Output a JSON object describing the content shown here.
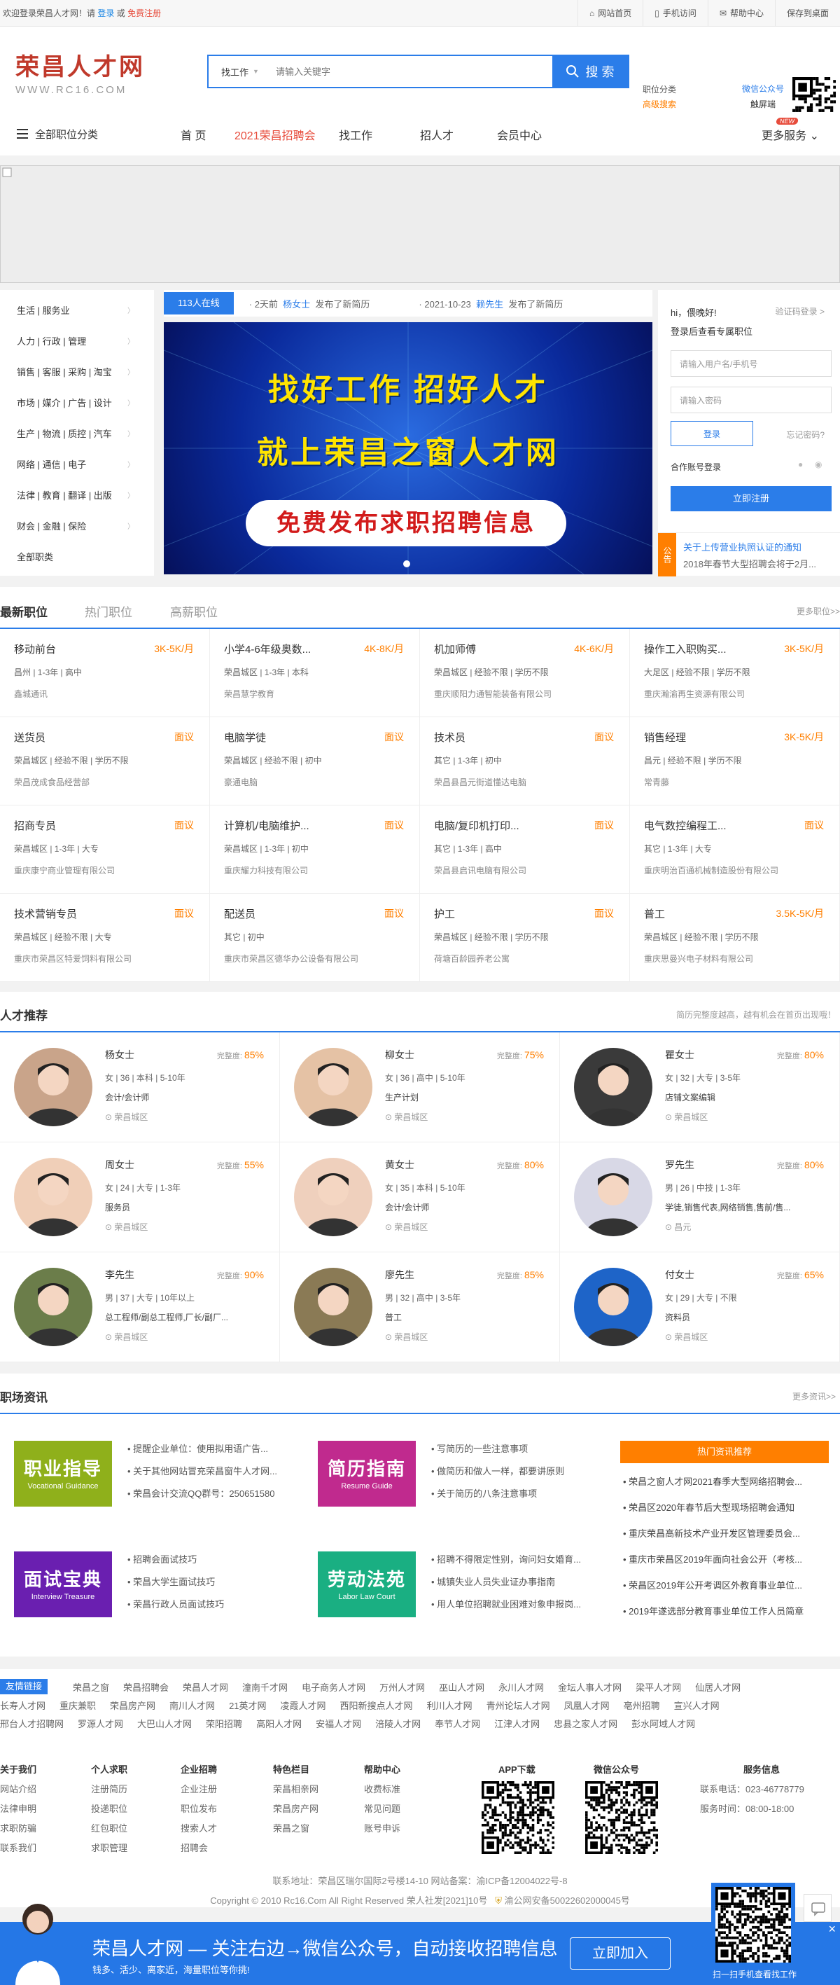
{
  "topbar": {
    "welcome": "欢迎登录荣昌人才网！请",
    "login": "登录",
    "or": "或",
    "register": "免费注册",
    "links": [
      "网站首页",
      "手机访问",
      "帮助中心",
      "保存到桌面"
    ]
  },
  "header": {
    "logo_cn": "荣昌人才网",
    "logo_en": "WWW.RC16.COM",
    "search_type": "找工作",
    "search_placeholder": "请输入关键字",
    "search_btn": "搜 索",
    "link_category": "职位分类",
    "link_advanced": "高级搜索",
    "wechat_title": "微信公众号",
    "wechat_sub": "触屏端"
  },
  "nav": {
    "category": "全部职位分类",
    "items": [
      "首 页",
      "2021荣昌招聘会",
      "找工作",
      "招人才",
      "会员中心"
    ],
    "new_badge": "NEW",
    "more": "更多服务"
  },
  "categories": [
    "生活 | 服务业",
    "人力 | 行政 | 管理",
    "销售 | 客服 | 采购 | 淘宝",
    "市场 | 媒介 | 广告 | 设计",
    "生产 | 物流 | 质控 | 汽车",
    "网络 | 通信 | 电子",
    "法律 | 教育 | 翻译 | 出版",
    "财会 | 金融 | 保险",
    "全部职类"
  ],
  "online": {
    "count": "113人在线",
    "entries": [
      {
        "time": "2天前",
        "who": "杨女士",
        "act": "发布了新简历"
      },
      {
        "time": "2021-10-23",
        "who": "赖先生",
        "act": "发布了新简历"
      }
    ]
  },
  "slide": {
    "line1": "找好工作 招好人才",
    "line2": "就上荣昌之窗人才网",
    "pill": "免费发布求职招聘信息"
  },
  "loginbox": {
    "hi": "hi，偎晚好!",
    "code_login": "验证码登录 >",
    "tip": "登录后查看专属职位",
    "user_ph": "请输入用户名/手机号",
    "pwd_ph": "请输入密码",
    "login": "登录",
    "forgot": "忘记密码?",
    "oauth": "合作账号登录",
    "register": "立即注册",
    "notice_tag": "公告",
    "notice1": "关于上传营业执照认证的通知",
    "notice2": "2018年春节大型招聘会将于2月..."
  },
  "job_tabs": [
    "最新职位",
    "热门职位",
    "高薪职位"
  ],
  "job_more": "更多职位>>",
  "jobs": [
    {
      "title": "移动前台",
      "salary": "3K-5K/月",
      "meta": "昌州 | 1-3年 | 高中",
      "company": "鑫城通讯"
    },
    {
      "title": "小学4-6年级奥数...",
      "salary": "4K-8K/月",
      "meta": "荣昌城区 | 1-3年 | 本科",
      "company": "荣昌慧学教育"
    },
    {
      "title": "机加师傅",
      "salary": "4K-6K/月",
      "meta": "荣昌城区 | 经验不限 | 学历不限",
      "company": "重庆顺阳力通智能装备有限公司"
    },
    {
      "title": "操作工入职购买...",
      "salary": "3K-5K/月",
      "meta": "大足区 | 经验不限 | 学历不限",
      "company": "重庆瀚渝再生资源有限公司"
    },
    {
      "title": "送货员",
      "salary": "面议",
      "meta": "荣昌城区 | 经验不限 | 学历不限",
      "company": "荣昌茂成食品经营部"
    },
    {
      "title": "电脑学徒",
      "salary": "面议",
      "meta": "荣昌城区 | 经验不限 | 初中",
      "company": "豪通电脑"
    },
    {
      "title": "技术员",
      "salary": "面议",
      "meta": "其它 | 1-3年 | 初中",
      "company": "荣昌县昌元街道懂达电脑"
    },
    {
      "title": "销售经理",
      "salary": "3K-5K/月",
      "meta": "昌元 | 经验不限 | 学历不限",
      "company": "常青藤"
    },
    {
      "title": "招商专员",
      "salary": "面议",
      "meta": "荣昌城区 | 1-3年 | 大专",
      "company": "重庆康宁商业管理有限公司"
    },
    {
      "title": "计算机/电脑维护...",
      "salary": "面议",
      "meta": "荣昌城区 | 1-3年 | 初中",
      "company": "重庆耀力科技有限公司"
    },
    {
      "title": "电脑/复印机打印...",
      "salary": "面议",
      "meta": "其它 | 1-3年 | 高中",
      "company": "荣昌县启讯电脑有限公司"
    },
    {
      "title": "电气数控编程工...",
      "salary": "面议",
      "meta": "其它 | 1-3年 | 大专",
      "company": "重庆明治百通机械制造股份有限公司"
    },
    {
      "title": "技术营销专员",
      "salary": "面议",
      "meta": "荣昌城区 | 经验不限 | 大专",
      "company": "重庆市荣昌区特爱饲料有限公司"
    },
    {
      "title": "配送员",
      "salary": "面议",
      "meta": "其它 | 初中",
      "company": "重庆市荣昌区德华办公设备有限公司"
    },
    {
      "title": "护工",
      "salary": "面议",
      "meta": "荣昌城区 | 经验不限 | 学历不限",
      "company": "荷塘百龄园养老公寓"
    },
    {
      "title": "普工",
      "salary": "3.5K-5K/月",
      "meta": "荣昌城区 | 经验不限 | 学历不限",
      "company": "重庆思曼兴电子材料有限公司"
    }
  ],
  "talent_section": {
    "title": "人才推荐",
    "note": "简历完整度越高，越有机会在首页出现哦！"
  },
  "talents": [
    {
      "name": "杨女士",
      "label": "完整度:",
      "pct": "85%",
      "info": "女 | 36 | 本科 | 5-10年",
      "job": "会计/会计师",
      "area": "荣昌城区"
    },
    {
      "name": "柳女士",
      "label": "完整度:",
      "pct": "75%",
      "info": "女 | 36 | 高中 | 5-10年",
      "job": "生产计划",
      "area": "荣昌城区"
    },
    {
      "name": "瞿女士",
      "label": "完整度:",
      "pct": "80%",
      "info": "女 | 32 | 大专 | 3-5年",
      "job": "店铺文案编辑",
      "area": "荣昌城区"
    },
    {
      "name": "周女士",
      "label": "完整度:",
      "pct": "55%",
      "info": "女 | 24 | 大专 | 1-3年",
      "job": "服务员",
      "area": "荣昌城区"
    },
    {
      "name": "黄女士",
      "label": "完整度:",
      "pct": "80%",
      "info": "女 | 35 | 本科 | 5-10年",
      "job": "会计/会计师",
      "area": "荣昌城区"
    },
    {
      "name": "罗先生",
      "label": "完整度:",
      "pct": "80%",
      "info": "男 | 26 | 中技 | 1-3年",
      "job": "学徒,销售代表,网络销售,售前/售...",
      "area": "昌元"
    },
    {
      "name": "李先生",
      "label": "完整度:",
      "pct": "90%",
      "info": "男 | 37 | 大专 | 10年以上",
      "job": "总工程师/副总工程师,厂长/副厂...",
      "area": "荣昌城区"
    },
    {
      "name": "廖先生",
      "label": "完整度:",
      "pct": "85%",
      "info": "男 | 32 | 高中 | 3-5年",
      "job": "普工",
      "area": "荣昌城区"
    },
    {
      "name": "付女士",
      "label": "完整度:",
      "pct": "65%",
      "info": "女 | 29 | 大专 | 不限",
      "job": "资料员",
      "area": "荣昌城区"
    }
  ],
  "news_section": {
    "title": "职场资讯",
    "more": "更多资讯>>"
  },
  "news_boxes": [
    {
      "big": "职业指导",
      "sm": "Vocational Guidance",
      "color": "#8fb01b",
      "list": [
        "提醒企业单位：使用拟用语广告...",
        "关于其他网站冒充荣昌窗牛人才网...",
        "荣昌会计交流QQ群号：250651580"
      ]
    },
    {
      "big": "简历指南",
      "sm": "Resume Guide",
      "color": "#c02a8e",
      "list": [
        "写简历的一些注意事项",
        "做简历和做人一样，都要讲原则",
        "关于简历的八条注意事项"
      ]
    },
    {
      "big": "面试宝典",
      "sm": "Interview Treasure",
      "color": "#6a1fb0",
      "list": [
        "招聘会面试技巧",
        "荣昌大学生面试技巧",
        "荣昌行政人员面试技巧"
      ]
    },
    {
      "big": "劳动法苑",
      "sm": "Labor Law Court",
      "color": "#1aaf82",
      "list": [
        "招聘不得限定性别，询问妇女婚育...",
        "城镇失业人员失业证办事指南",
        "用人单位招聘就业困难对象申报岗..."
      ]
    }
  ],
  "hot_news": {
    "title": "热门资讯推荐",
    "items": [
      "荣昌之窗人才网2021春季大型网络招聘会...",
      "荣昌区2020年春节后大型现场招聘会通知",
      "重庆荣昌高新技术产业开发区管理委员会...",
      "重庆市荣昌区2019年面向社会公开（考核...",
      "荣昌区2019年公开考调区外教育事业单位...",
      "2019年遂选部分教育事业单位工作人员简章"
    ]
  },
  "links": {
    "tag": "友情链接",
    "row1": [
      "荣昌之窗",
      "荣昌招聘会",
      "荣昌人才网",
      "潼南千才网",
      "电子商务人才网",
      "万州人才网",
      "巫山人才网",
      "永川人才网",
      "金坛人事人才网",
      "梁平人才网",
      "仙居人才网"
    ],
    "row2": [
      "长寿人才网",
      "重庆兼职",
      "荣昌房产网",
      "南川人才网",
      "21英才网",
      "凌霞人才网",
      "西阳新搜点人才网",
      "利川人才网",
      "青州论坛人才网",
      "凤凰人才网",
      "亳州招聘",
      "宣兴人才网"
    ],
    "row3": [
      "邢台人才招聘网",
      "罗源人才网",
      "大巴山人才网",
      "荣阳招聘",
      "高阳人才网",
      "安福人才网",
      "涪陵人才网",
      "奉节人才网",
      "江津人才网",
      "忠县之家人才网",
      "彭水阿域人才网"
    ]
  },
  "footer": {
    "cols": [
      {
        "h": "关于我们",
        "items": [
          "网站介绍",
          "法律申明",
          "求职防骗",
          "联系我们"
        ]
      },
      {
        "h": "个人求职",
        "items": [
          "注册简历",
          "投递职位",
          "红包职位",
          "求职管理"
        ]
      },
      {
        "h": "企业招聘",
        "items": [
          "企业注册",
          "职位发布",
          "搜索人才",
          "招聘会"
        ]
      },
      {
        "h": "特色栏目",
        "items": [
          "荣昌相亲网",
          "荣昌房产网",
          "荣昌之窗"
        ]
      },
      {
        "h": "帮助中心",
        "items": [
          "收费标准",
          "常见问题",
          "账号申诉"
        ]
      }
    ],
    "app": "APP下载",
    "wx": "微信公众号",
    "service_h": "服务信息",
    "phone": "联系电话：023-46778779",
    "hours": "服务时间：08:00-18:00",
    "address": "联系地址：荣昌区瑞尔国际2号楼14-10 网站备案：渝ICP备12004022号-8",
    "copyright": "Copyright © 2010 Rc16.Com All Right Reserved 荣人社发[2021]10号",
    "police": "渝公网安备50022602000045号"
  },
  "bottombar": {
    "title": "荣昌人才网 — 关注右边→微信公众号，自动接收招聘信息",
    "sub": "钱多、活少、离家近，海量职位等你挑!",
    "join": "立即加入",
    "qr_tip": "扫一扫手机查看找工作",
    "close": "×"
  },
  "colors": {
    "primary": "#2b7de9",
    "accent": "#ff7f00",
    "brand": "#c0392b"
  }
}
